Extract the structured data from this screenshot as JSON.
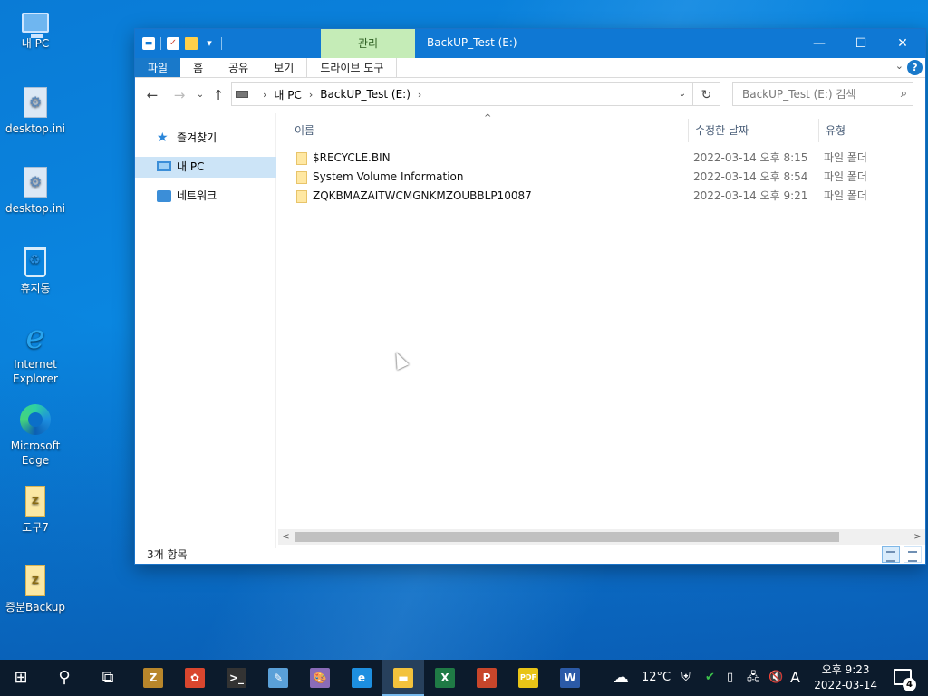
{
  "desktop": {
    "icons": [
      {
        "label": "내 PC",
        "icon": "computer-icon"
      },
      {
        "label": "desktop.ini",
        "icon": "settings-file-icon"
      },
      {
        "label": "desktop.ini",
        "icon": "settings-file-icon"
      },
      {
        "label": "휴지통",
        "icon": "recycle-bin-icon"
      },
      {
        "label_line1": "Internet",
        "label_line2": "Explorer",
        "icon": "internet-explorer-icon"
      },
      {
        "label_line1": "Microsoft",
        "label_line2": "Edge",
        "icon": "edge-icon"
      },
      {
        "label": "도구7",
        "icon": "folder-zip-icon"
      },
      {
        "label": "증분Backup",
        "icon": "folder-zip-icon"
      }
    ]
  },
  "window": {
    "title": "BackUP_Test (E:)",
    "contextual_tab": "관리",
    "buttons": {
      "minimize": "—",
      "maximize": "☐",
      "close": "✕"
    },
    "ribbon_tabs": [
      "파일",
      "홈",
      "공유",
      "보기",
      "드라이브 도구"
    ],
    "ribbon_expand": "⌄",
    "help": "?",
    "nav": {
      "back": "←",
      "forward": "→",
      "recent": "⌄",
      "up": "↑"
    },
    "address": {
      "crumbs": [
        "내 PC",
        "BackUP_Test (E:)"
      ],
      "sep": "›",
      "dropdown": "⌄"
    },
    "refresh": "↻",
    "search_placeholder": "BackUP_Test (E:) 검색",
    "search_icon": "⌕",
    "nav_pane": [
      {
        "label": "즐겨찾기",
        "icon": "star-icon",
        "selected": false
      },
      {
        "label": "내 PC",
        "icon": "computer-icon",
        "selected": true
      },
      {
        "label": "네트워크",
        "icon": "network-icon",
        "selected": false
      }
    ],
    "columns": {
      "name": "이름",
      "date": "수정한 날짜",
      "type": "유형"
    },
    "sort_arrow": "^",
    "files": [
      {
        "name": "$RECYCLE.BIN",
        "date": "2022-03-14 오후 8:15",
        "type": "파일 폴더"
      },
      {
        "name": "System Volume Information",
        "date": "2022-03-14 오후 8:54",
        "type": "파일 폴더"
      },
      {
        "name": "ZQKBMAZAITWCMGNKMZOUBBLP10087",
        "date": "2022-03-14 오후 9:21",
        "type": "파일 폴더"
      }
    ],
    "status": "3개 항목",
    "scroll": {
      "left": "<",
      "right": ">"
    }
  },
  "taskbar": {
    "start": "⊞",
    "search": "⚲",
    "task_view": "⧉",
    "apps": [
      {
        "name": "tool-app-icon",
        "glyph": "Z",
        "color": "#b8862b",
        "active": false
      },
      {
        "name": "paint-app-icon",
        "glyph": "✿",
        "color": "#d9462e",
        "active": false
      },
      {
        "name": "terminal-icon",
        "glyph": ">_",
        "color": "#333333",
        "active": false
      },
      {
        "name": "notepad-icon",
        "glyph": "✎",
        "color": "#5aa0d8",
        "active": false
      },
      {
        "name": "palette-icon",
        "glyph": "🎨",
        "color": "#8a6bb8",
        "active": false
      },
      {
        "name": "edge-icon",
        "glyph": "e",
        "color": "#1d8fe0",
        "active": false
      },
      {
        "name": "file-explorer-icon",
        "glyph": "▬",
        "color": "#f3c23c",
        "active": true
      },
      {
        "name": "excel-icon",
        "glyph": "X",
        "color": "#1f7a45",
        "active": false
      },
      {
        "name": "powerpoint-icon",
        "glyph": "P",
        "color": "#c8462b",
        "active": false
      },
      {
        "name": "pdf-icon",
        "glyph": "PDF",
        "color": "#e8c417",
        "active": false
      },
      {
        "name": "word-icon",
        "glyph": "W",
        "color": "#2b5aa8",
        "active": false
      }
    ],
    "weather": "12°C",
    "weather_icon": "☁",
    "ime": "A",
    "time": "오후 9:23",
    "date": "2022-03-14",
    "notification_count": "4"
  }
}
